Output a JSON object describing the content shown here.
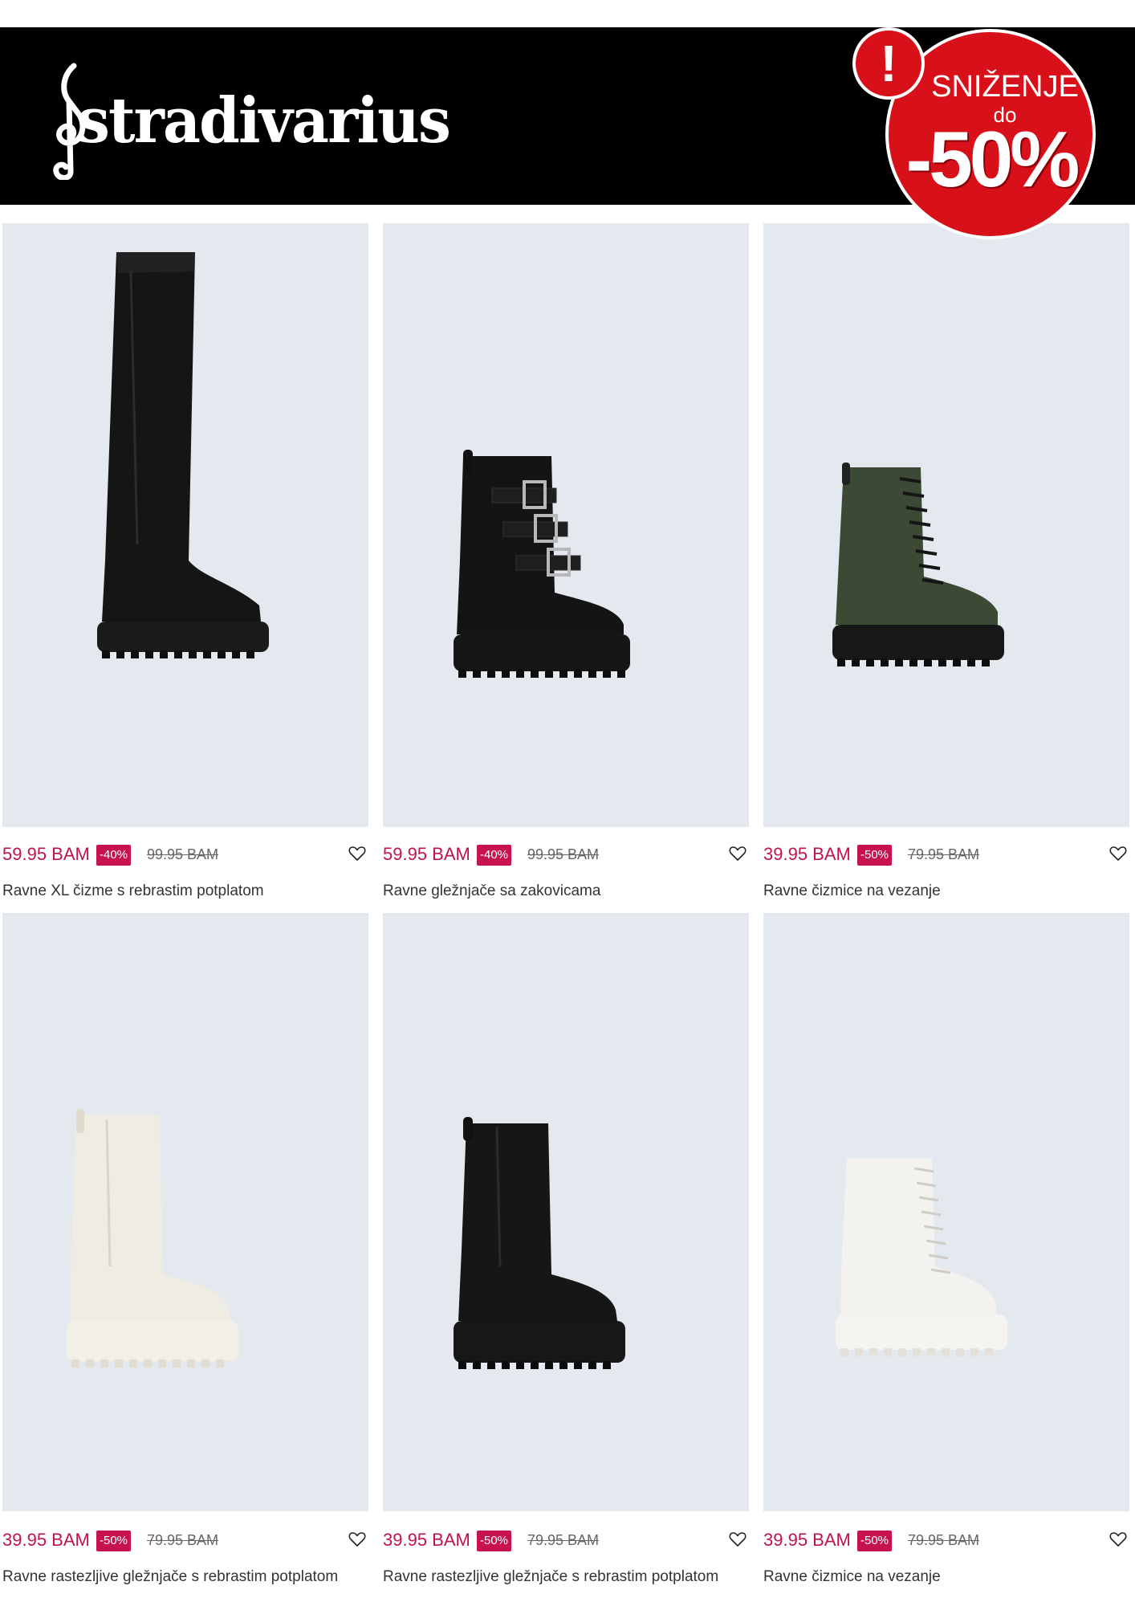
{
  "brand": {
    "name": "stradivarius"
  },
  "promo": {
    "line1": "SNIŽENJE",
    "line2": "do",
    "line3": "-50%",
    "mark": "!"
  },
  "colors": {
    "price": "#c1124f",
    "badge": "#d8101a",
    "image_bg": "#e4e9ef"
  },
  "products": [
    {
      "price": "59.95 BAM",
      "discount": "-40%",
      "old_price": "99.95 BAM",
      "name": "Ravne XL čizme s rebrastim potplatom",
      "boot": "tall-black"
    },
    {
      "price": "59.95 BAM",
      "discount": "-40%",
      "old_price": "99.95 BAM",
      "name": "Ravne gležnjače sa zakovicama",
      "boot": "buckle-black"
    },
    {
      "price": "39.95 BAM",
      "discount": "-50%",
      "old_price": "79.95 BAM",
      "name": "Ravne čizmice na vezanje",
      "boot": "lace-green"
    },
    {
      "price": "39.95 BAM",
      "discount": "-50%",
      "old_price": "79.95 BAM",
      "name": "Ravne rastezljive gležnjače s rebrastim potplatom",
      "boot": "chelsea-cream"
    },
    {
      "price": "39.95 BAM",
      "discount": "-50%",
      "old_price": "79.95 BAM",
      "name": "Ravne rastezljive gležnjače s rebrastim potplatom",
      "boot": "chelsea-black"
    },
    {
      "price": "39.95 BAM",
      "discount": "-50%",
      "old_price": "79.95 BAM",
      "name": "Ravne čizmice na vezanje",
      "boot": "lace-white"
    }
  ]
}
